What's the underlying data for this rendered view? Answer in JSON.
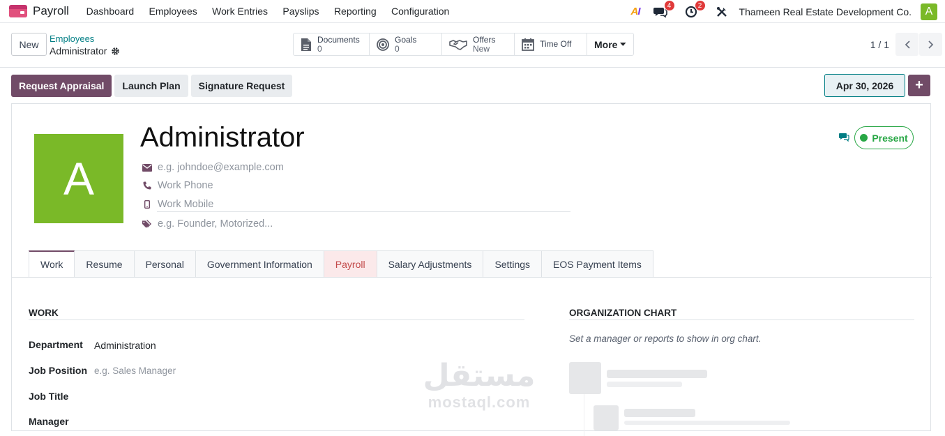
{
  "topnav": {
    "app_name": "Payroll",
    "menu": [
      "Dashboard",
      "Employees",
      "Work Entries",
      "Payslips",
      "Reporting",
      "Configuration"
    ],
    "ai_label": "AI",
    "messages_count": "4",
    "activities_count": "2",
    "company": "Thameen Real Estate Development Co.",
    "user_initial": "A"
  },
  "control": {
    "new_label": "New",
    "breadcrumb_parent": "Employees",
    "breadcrumb_current": "Administrator",
    "smart_buttons": [
      {
        "label": "Documents",
        "value": "0",
        "icon": "document-icon"
      },
      {
        "label": "Goals",
        "value": "0",
        "icon": "target-icon"
      },
      {
        "label": "Offers",
        "value": "New",
        "icon": "handshake-icon"
      },
      {
        "label": "Time Off",
        "value": "",
        "icon": "calendar-icon"
      }
    ],
    "more_label": "More",
    "pager_value": "1 / 1"
  },
  "actions": {
    "request_appraisal": "Request Appraisal",
    "launch_plan": "Launch Plan",
    "signature_request": "Signature Request",
    "date": "Apr 30, 2026",
    "plus": "+"
  },
  "employee": {
    "avatar_initial": "A",
    "name": "Administrator",
    "email_placeholder": "e.g. johndoe@example.com",
    "work_phone_placeholder": "Work Phone",
    "work_mobile_placeholder": "Work Mobile",
    "tags_placeholder": "e.g. Founder, Motorized...",
    "presence": "Present"
  },
  "tabs": [
    "Work",
    "Resume",
    "Personal",
    "Government Information",
    "Payroll",
    "Salary Adjustments",
    "Settings",
    "EOS Payment Items"
  ],
  "work_section": {
    "title": "WORK",
    "fields": [
      {
        "label": "Department",
        "value": "Administration",
        "placeholder": false
      },
      {
        "label": "Job Position",
        "value": "e.g. Sales Manager",
        "placeholder": true
      },
      {
        "label": "Job Title",
        "value": "",
        "placeholder": false
      },
      {
        "label": "Manager",
        "value": "",
        "placeholder": false
      }
    ]
  },
  "org_section": {
    "title": "ORGANIZATION CHART",
    "hint": "Set a manager or reports to show in org chart."
  },
  "watermark": {
    "arabic": "مستقل",
    "latin": "mostaql.com"
  },
  "colors": {
    "primary": "#714b67",
    "teal": "#017e84",
    "avatar_green": "#7ab928",
    "present_green": "#28a745",
    "badge_red": "#e03a3a"
  }
}
